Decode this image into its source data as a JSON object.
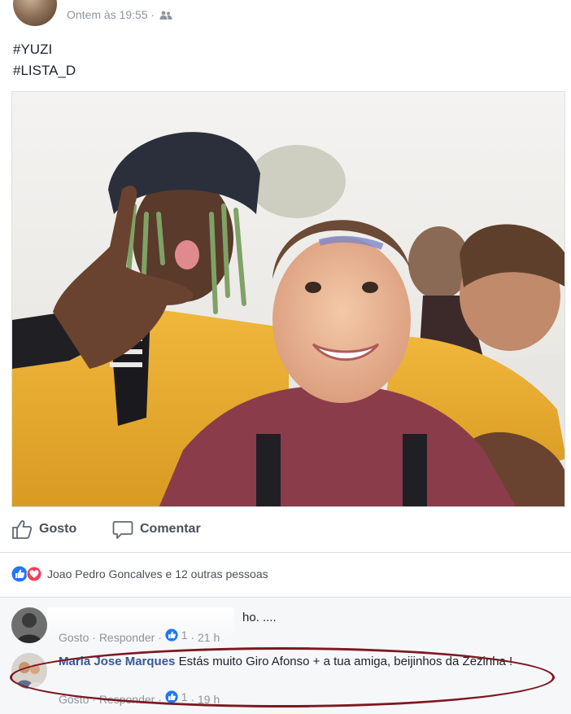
{
  "post": {
    "timestamp": "Ontem às 19:55 ·",
    "audience_icon": "friends-icon",
    "hashtags": [
      "#YUZI",
      "#LISTA_D"
    ]
  },
  "actions": {
    "like_label": "Gosto",
    "comment_label": "Comentar"
  },
  "reactions": {
    "icons": [
      "like-reaction-icon",
      "love-reaction-icon"
    ],
    "summary": "Joao Pedro Goncalves e 12 outras pessoas"
  },
  "comments": [
    {
      "author": "",
      "text": "ho. ....",
      "like_label": "Gosto",
      "reply_label": "Responder",
      "likes": "1",
      "time": "21 h"
    },
    {
      "author": "Maria Jose Marques",
      "text": "Estás muito Giro Afonso + a tua amiga, beijinhos da Zézinha !",
      "like_label": "Gosto",
      "reply_label": "Responder",
      "likes": "1",
      "time": "19 h"
    }
  ],
  "colors": {
    "link_blue": "#385898",
    "like_blue": "#2078f4",
    "love_red": "#f33e58",
    "highlight_ring": "#7d1821"
  }
}
